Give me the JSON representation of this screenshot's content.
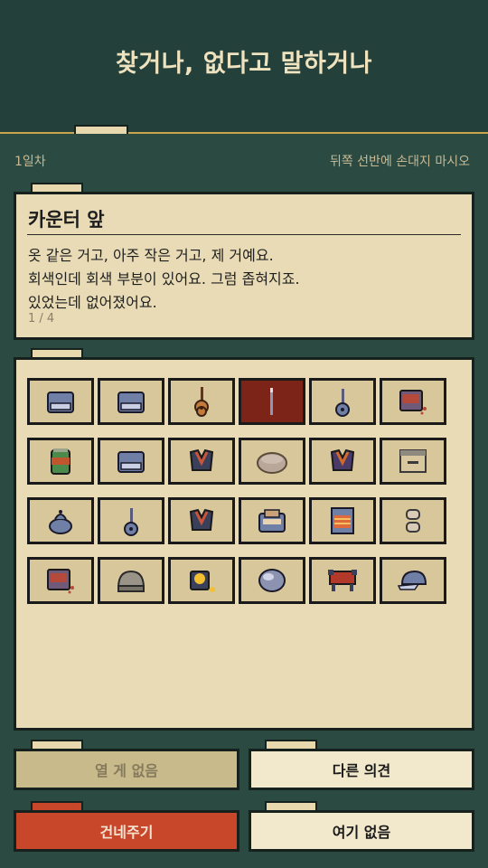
{
  "header": {
    "title": "찾거나, 없다고 말하거나"
  },
  "status": {
    "day": "1일차",
    "hint": "뒤쪽 선반에 손대지 마시오"
  },
  "dialog": {
    "speaker": "카운터 앞",
    "lines": [
      "옷 같은 거고, 아주 작은 거고, 제 거예요.",
      "회색인데 회색 부분이 있어요. 그럼 좁혀지죠.",
      "있었는데 없어졌어요."
    ],
    "page": "1 / 4"
  },
  "shelf": {
    "rows": [
      [
        "box-icon",
        "box-icon",
        "guitar-icon",
        "pin-icon",
        "small-guitar-icon",
        "radio-icon"
      ],
      [
        "can-icon",
        "box-icon",
        "vest-icon",
        "bun-icon",
        "purple-vest-icon",
        "crate-icon"
      ],
      [
        "teapot-icon",
        "small-guitar-icon",
        "vest-icon",
        "bag-icon",
        "cabinet-icon",
        "stack-icon"
      ],
      [
        "radio-icon",
        "cake-icon",
        "lamp-icon",
        "stone-icon",
        "bench-icon",
        "cap-icon"
      ]
    ],
    "selected_index": 3
  },
  "actions": {
    "nothing_to_open": "열 게 없음",
    "other_opinion": "다른 의견",
    "hand_over": "건네주기",
    "not_here": "여기 없음"
  },
  "colors": {
    "background": "#2a4a42",
    "panel": "#e8dbb5",
    "accent_red": "#c8462a",
    "selected_slot": "#7d2418",
    "gold_rule": "#c9a74a"
  }
}
